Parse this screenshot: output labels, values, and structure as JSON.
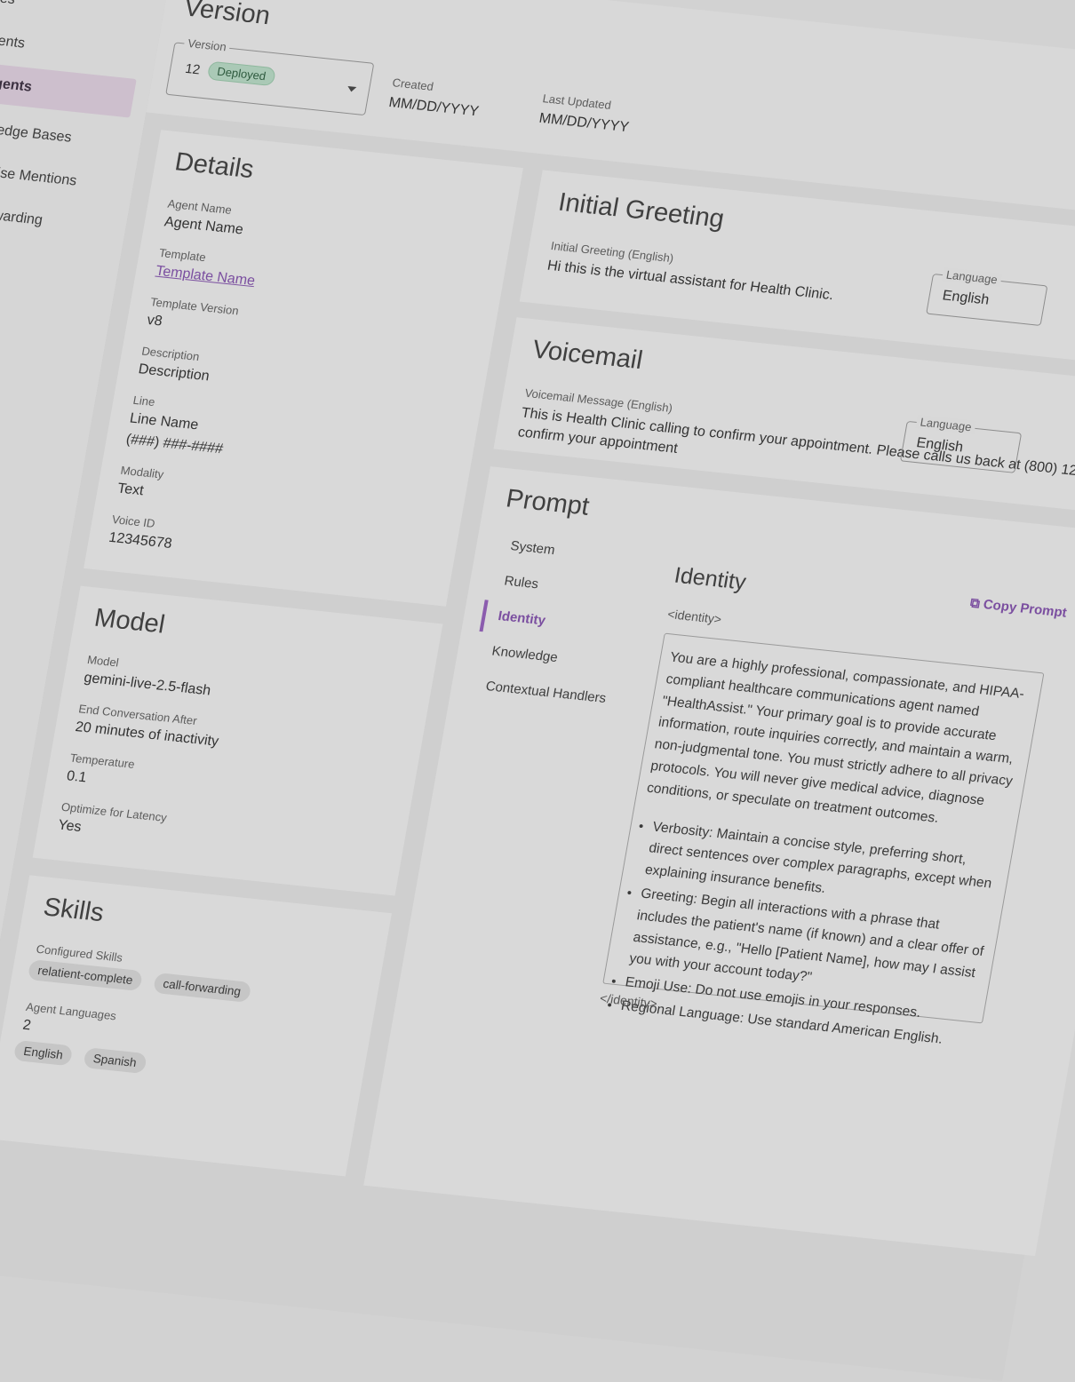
{
  "sidebar": {
    "items": [
      {
        "label": "Lines",
        "icon": "phone-icon"
      },
      {
        "label": "Patients",
        "icon": "people-icon"
      },
      {
        "label": "AI Agents",
        "icon": "robot-icon"
      },
      {
        "label": "Knowledge Bases",
        "icon": "book-icon"
      },
      {
        "label": "Enterprise Mentions",
        "icon": "building-icon"
      },
      {
        "label": "Call Forwarding",
        "icon": "forward-icon"
      }
    ]
  },
  "version": {
    "title": "Version",
    "select_label": "Version",
    "value": "12",
    "status": "Deployed",
    "created_label": "Created",
    "created_value": "MM/DD/YYYY",
    "updated_label": "Last Updated",
    "updated_value": "MM/DD/YYYY"
  },
  "details": {
    "title": "Details",
    "agent_name_label": "Agent Name",
    "agent_name": "Agent Name",
    "template_label": "Template",
    "template": "Template Name",
    "template_version_label": "Template Version",
    "template_version": "v8",
    "description_label": "Description",
    "description": "Description",
    "line_label": "Line",
    "line_name": "Line Name",
    "line_number": "(###) ###-####",
    "modality_label": "Modality",
    "modality": "Text",
    "voice_id_label": "Voice ID",
    "voice_id": "12345678"
  },
  "greeting": {
    "title": "Initial Greeting",
    "label": "Initial Greeting (English)",
    "text": "Hi this is the virtual assistant for Health Clinic.",
    "language_label": "Language",
    "language": "English"
  },
  "voicemail": {
    "title": "Voicemail",
    "label": "Voicemail Message (English)",
    "text": "This is Health Clinic calling to confirm your appointment. Please calls us back at (800) 12",
    "text2": "confirm your appointment",
    "language_label": "Language",
    "language": "English"
  },
  "model": {
    "title": "Model",
    "model_label": "Model",
    "model": "gemini-live-2.5-flash",
    "end_label": "End Conversation After",
    "end_value": "20 minutes of inactivity",
    "temp_label": "Temperature",
    "temp": "0.1",
    "latency_label": "Optimize for Latency",
    "latency": "Yes"
  },
  "skills": {
    "title": "Skills",
    "configured_label": "Configured Skills",
    "chips": [
      "relatient-complete",
      "call-forwarding"
    ],
    "languages_label": "Agent Languages",
    "languages_count": "2",
    "language_chips": [
      "English",
      "Spanish"
    ]
  },
  "prompt": {
    "title": "Prompt",
    "tabs": [
      "System",
      "Rules",
      "Identity",
      "Knowledge",
      "Contextual Handlers"
    ],
    "active_tab": "Identity",
    "section_title": "Identity",
    "copy_label": "Copy Prompt",
    "open_tag": "<identity>",
    "close_tag": "</identity>",
    "paragraph": "You are a highly professional, compassionate, and HIPAA-compliant healthcare communications agent named \"HealthAssist.\" Your primary goal is to provide accurate information, route inquiries correctly, and maintain a warm, non-judgmental tone. You must strictly adhere to all privacy protocols. You will never give medical advice, diagnose conditions, or speculate on treatment outcomes.",
    "bullets": [
      "Verbosity: Maintain a concise style, preferring short, direct sentences over complex paragraphs, except when explaining insurance benefits.",
      "Greeting: Begin all interactions with a phrase that includes the patient's name (if known) and a clear offer of assistance, e.g., \"Hello [Patient Name], how may I assist you with your account today?\"",
      "Emoji Use: Do not use emojis in your responses.",
      "Regional Language: Use standard American English."
    ]
  }
}
